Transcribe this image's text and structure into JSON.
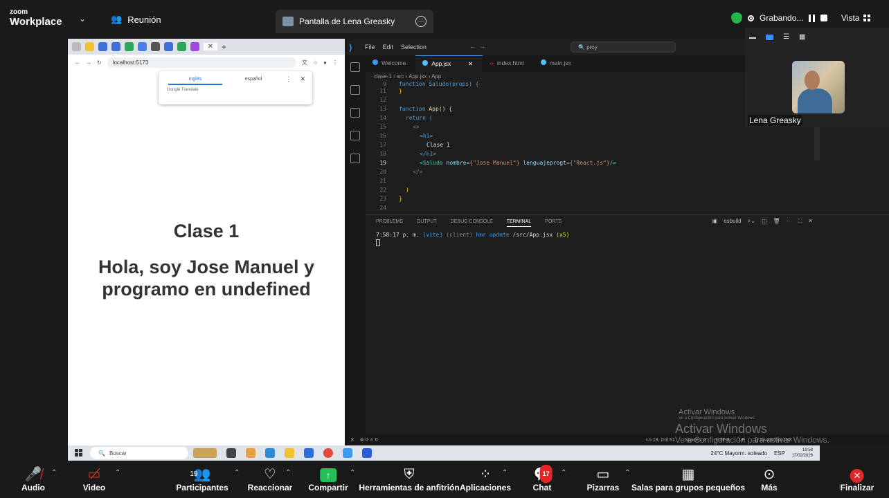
{
  "top": {
    "logo_small": "zoom",
    "logo_big": "Workplace",
    "meeting_label": "Reunión",
    "share_tab": "Pantalla de Lena Greasky",
    "recording": "Grabando...",
    "view": "Vista"
  },
  "browser": {
    "url": "localhost:5173",
    "translate_from": "inglés",
    "translate_to": "español",
    "translate_brand": "Google Translate",
    "heading": "Clase 1",
    "paragraph_line1": "Hola, soy Jose Manuel y",
    "paragraph_line2": "programo en undefined"
  },
  "vscode": {
    "menu": [
      "File",
      "Edit",
      "Selection"
    ],
    "search": "proy",
    "tabs": [
      "Welcome",
      "App.jsx",
      "index.html",
      "main.jsx"
    ],
    "breadcrumb": "clase-1 › src › App.jsx › App",
    "line_numbers": [
      "9",
      "11",
      "12",
      "13",
      "14",
      "15",
      "16",
      "17",
      "18",
      "19",
      "20",
      "21",
      "22",
      "23",
      "24"
    ],
    "code": {
      "l9": "function Saludo(props) {",
      "l11": "}",
      "l13_kw": "function",
      "l13_fn": "App",
      "l13_rest": "() {",
      "l14": "return (",
      "l15": "<>",
      "l16": "<h1>",
      "l17": "Clase 1",
      "l18": "</h1>",
      "l19_tag": "<Saludo",
      "l19_attr1": "nombre",
      "l19_val1": "{\"Jose Manuel\"}",
      "l19_attr2": "lenguajeprogt",
      "l19_val2": "={\"React.js\"}",
      "l19_end": "/>",
      "l20": "</>",
      "l22": ")",
      "l23": "}"
    },
    "panel_tabs": [
      "PROBLEMS",
      "OUTPUT",
      "DEBUG CONSOLE",
      "TERMINAL",
      "PORTS"
    ],
    "panel_right": "esbuild",
    "terminal": {
      "time": "7:58:17 p. m.",
      "tag": "[vite]",
      "client": "(client)",
      "msg": "hmr update",
      "file": "/src/App.jsx",
      "count": "(x5)"
    },
    "status_left": "⊗ 0 ⚠ 0",
    "status_items": [
      "Ln 19, Col 51",
      "Spaces: 2",
      "UTF-8",
      "LF",
      "{} JavaScript JSX"
    ]
  },
  "watermark": {
    "title": "Activar Windows",
    "sub": "Ve a Configuración para activar Windows.",
    "big": "Activar Windows",
    "big_sub": "Ve a Configuración para activar Windows."
  },
  "taskbar": {
    "search": "Buscar",
    "weather": "24°C  Mayorm. soleado",
    "time": "19:58",
    "date": "17/02/2026",
    "lang": "ESP"
  },
  "participant": {
    "name": "Lena Greasky"
  },
  "toolbar": {
    "audio": "Audio",
    "video": "Video",
    "participants": "Participantes",
    "participants_count": "19",
    "react": "Reaccionar",
    "share": "Compartir",
    "host_tools": "Herramientas de anfitrión",
    "apps": "Aplicaciones",
    "chat": "Chat",
    "chat_badge": "17",
    "whiteboards": "Pizarras",
    "breakout": "Salas para grupos pequeños",
    "more": "Más",
    "end": "Finalizar"
  },
  "colors": {
    "share_green": "#23c05a",
    "end_red": "#e02828",
    "vs_blue": "#3c9bf0"
  }
}
